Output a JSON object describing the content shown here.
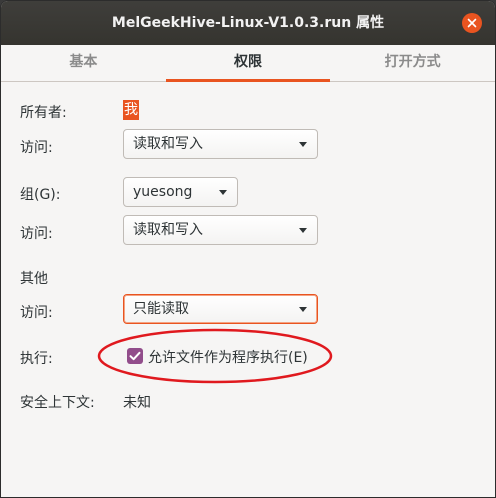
{
  "window": {
    "title": "MelGeekHive-Linux-V1.0.3.run 属性"
  },
  "tabs": [
    {
      "label": "基本"
    },
    {
      "label": "权限"
    },
    {
      "label": "打开方式"
    }
  ],
  "permissions": {
    "owner_label": "所有者:",
    "owner_value": "我",
    "owner_access_label": "访问:",
    "owner_access_value": "读取和写入",
    "group_label": "组(G):",
    "group_value": "yuesong",
    "group_access_label": "访问:",
    "group_access_value": "读取和写入",
    "others_label": "其他",
    "others_access_label": "访问:",
    "others_access_value": "只能读取",
    "execute_label": "执行:",
    "execute_checkbox_label": "允许文件作为程序执行(E)",
    "execute_checked": true,
    "security_context_label": "安全上下文:",
    "security_context_value": "未知"
  },
  "colors": {
    "accent": "#e95420",
    "checkbox": "#924d8b",
    "annotation": "#e0191e"
  }
}
